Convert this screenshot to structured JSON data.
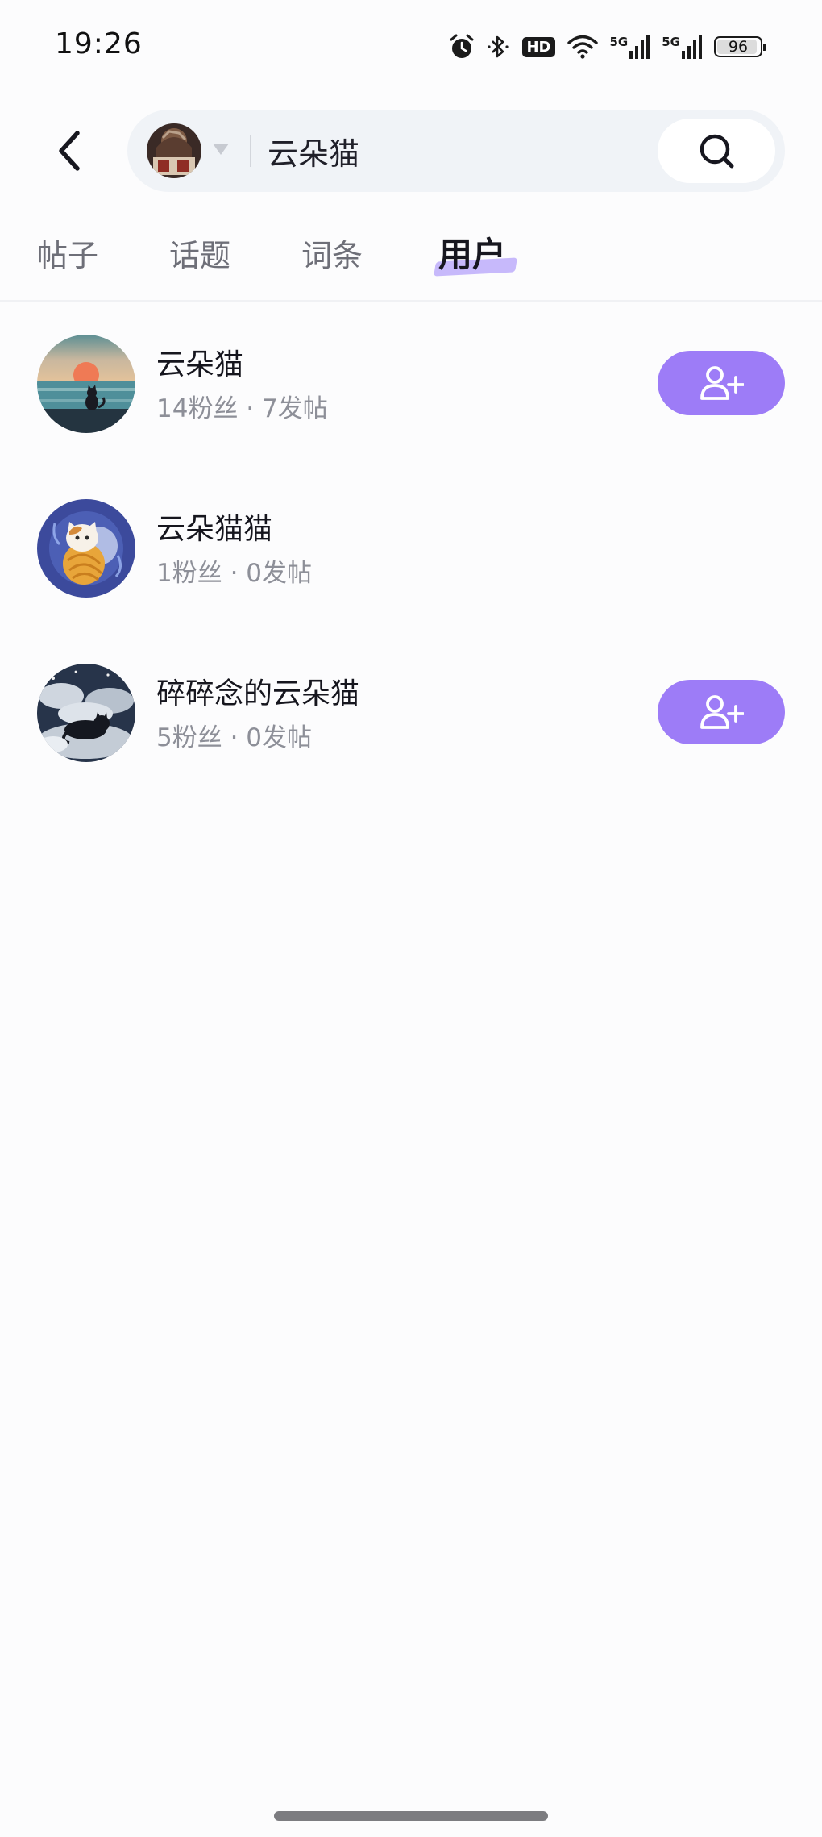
{
  "status_bar": {
    "time": "19:26",
    "hd_label": "HD",
    "network_1": "5G",
    "network_2": "5G",
    "battery_level": "96",
    "icons": [
      "alarm-icon",
      "bluetooth-icon",
      "hd-icon",
      "wifi-icon",
      "signal-5g-icon",
      "signal-5g-icon",
      "battery-icon"
    ]
  },
  "header": {
    "back_icon": "chevron-left-icon",
    "search": {
      "value": "云朵猫",
      "avatar_icon": "avatar",
      "dropdown_icon": "caret-down-icon",
      "button_icon": "search-icon"
    }
  },
  "tabs": [
    {
      "label": "帖子",
      "active": false
    },
    {
      "label": "话题",
      "active": false
    },
    {
      "label": "词条",
      "active": false
    },
    {
      "label": "用户",
      "active": true
    }
  ],
  "users": [
    {
      "name": "云朵猫",
      "stats": "14粉丝 · 7发帖",
      "follow_button": true
    },
    {
      "name": "云朵猫猫",
      "stats": "1粉丝 · 0发帖",
      "follow_button": false
    },
    {
      "name": "碎碎念的云朵猫",
      "stats": "5粉丝 · 0发帖",
      "follow_button": true
    }
  ],
  "colors": {
    "accent": "#9d7cf7",
    "tab_highlight": "#c7b9fb",
    "search_bg": "#f0f3f7",
    "muted_text": "#8d8f98"
  }
}
